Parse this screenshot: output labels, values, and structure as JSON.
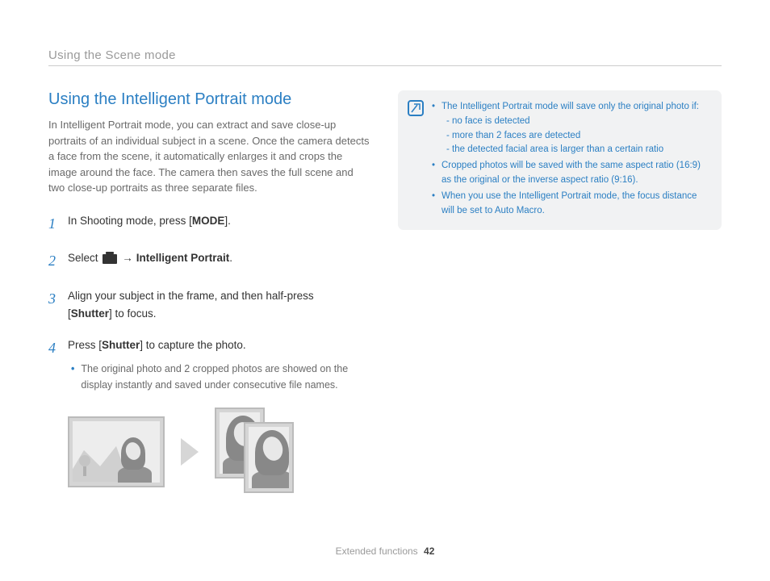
{
  "header": {
    "section": "Using the Scene mode"
  },
  "title": "Using the Intelligent Portrait mode",
  "intro": "In Intelligent Portrait mode, you can extract and save close-up portraits of an individual subject in a scene. Once the camera detects a face from the scene, it automatically enlarges it and crops the image around the face. The camera then saves the full scene and two close-up portraits as three separate files.",
  "steps": {
    "s1": {
      "num": "1",
      "prefix": "In Shooting mode, press [",
      "mode": "MODE",
      "suffix": "]."
    },
    "s2": {
      "num": "2",
      "prefix": "Select ",
      "arrow": "→",
      "bold": "Intelligent Portrait",
      "suffix": "."
    },
    "s3": {
      "num": "3",
      "line1": "Align your subject in the frame, and then half-press",
      "bold": "Shutter",
      "line2": "] to focus."
    },
    "s4": {
      "num": "4",
      "prefix": "Press [",
      "bold": "Shutter",
      "suffix": "] to capture the photo.",
      "bullet": "The original photo and 2 cropped photos are showed on the display instantly and saved under consecutive file names."
    }
  },
  "notes": {
    "n1": "The Intelligent Portrait mode will save only the original photo if:",
    "n1a": "no face is detected",
    "n1b": "more than 2 faces are detected",
    "n1c": "the detected facial area is larger than a certain ratio",
    "n2": "Cropped photos will be saved with the same aspect ratio (16:9) as the original or the inverse aspect ratio (9:16).",
    "n3": "When you use the Intelligent Portrait mode, the focus distance will be set to Auto Macro."
  },
  "footer": {
    "label": "Extended functions",
    "page": "42"
  }
}
